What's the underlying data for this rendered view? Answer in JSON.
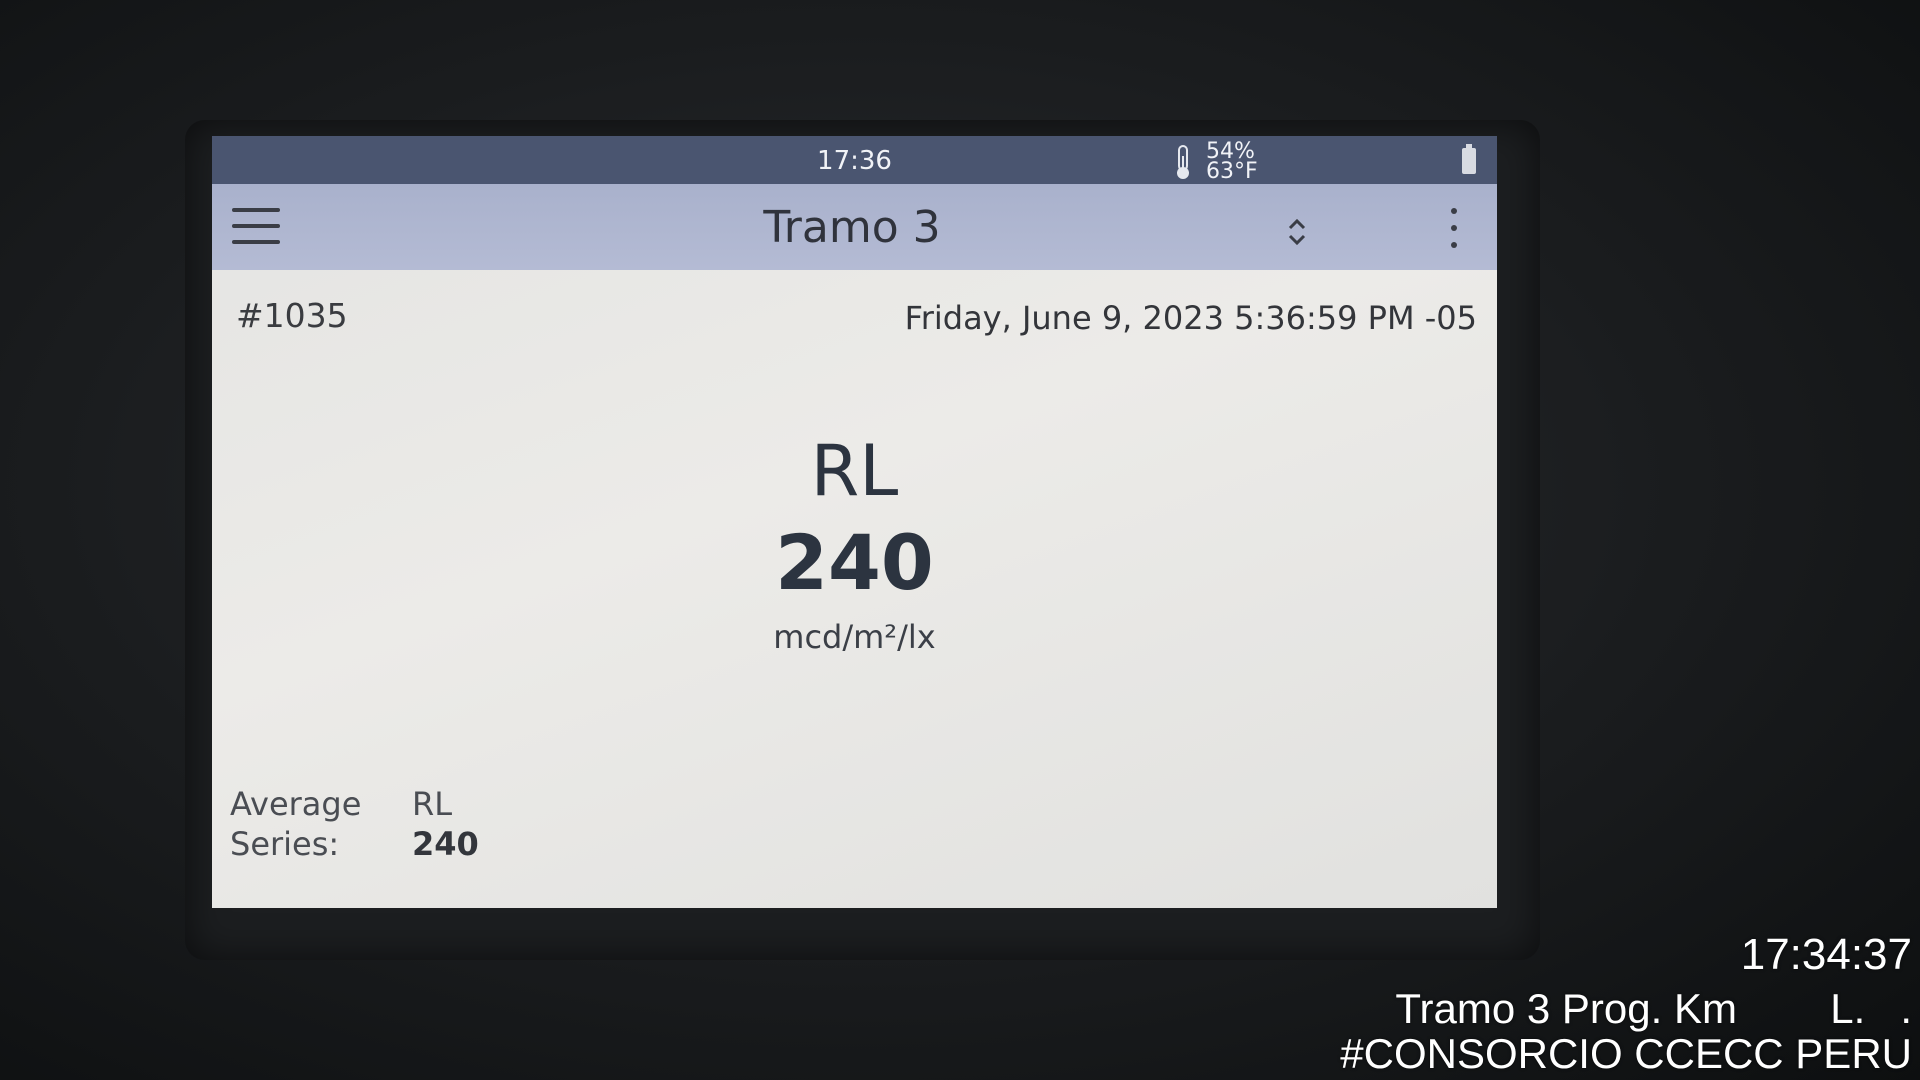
{
  "status_bar": {
    "time": "17:36",
    "humidity": "54%",
    "temperature": "63°F",
    "icons": [
      "thermometer-icon",
      "battery-icon"
    ]
  },
  "app_bar": {
    "title": "Tramo 3",
    "icons": [
      "menu-icon",
      "sort-icon",
      "more-options-icon"
    ]
  },
  "record": {
    "id": "#1035",
    "timestamp": "Friday, June 9, 2023 5:36:59 PM -05"
  },
  "measurement": {
    "label": "RL",
    "value": "240",
    "unit": "mcd/m²/lx"
  },
  "series_average": {
    "label_line1": "Average",
    "label_line2": "Series:",
    "metric": "RL",
    "value": "240"
  },
  "photo_overlay": {
    "time": "17:34:37",
    "location": "Tramo 3 Prog. Km        L.   .",
    "organization": "#CONSORCIO CCECC PERU"
  },
  "colors": {
    "status_bar_bg": "#4a5570",
    "app_bar_bg": "#aeb5cf",
    "screen_bg": "#e6e6e3",
    "text_dark": "#2c3440"
  }
}
